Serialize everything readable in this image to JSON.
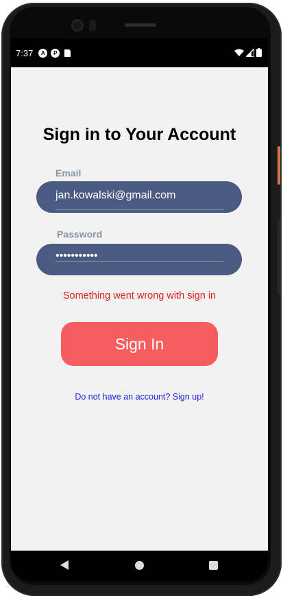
{
  "status_bar": {
    "time": "7:37",
    "left_icons": [
      "app-a-icon",
      "app-p-icon",
      "sd-card-icon"
    ],
    "right_icons": [
      "wifi-icon",
      "signal-icon",
      "battery-icon"
    ]
  },
  "screen": {
    "title": "Sign in to Your Account",
    "email": {
      "label": "Email",
      "value": "jan.kowalski@gmail.com"
    },
    "password": {
      "label": "Password",
      "value": "•••••••••••"
    },
    "error_message": "Something went wrong with sign in",
    "sign_in_button": "Sign In",
    "sign_up_link": "Do not have an account? Sign up!"
  },
  "colors": {
    "input_background": "#4b5a80",
    "button": "#f75c5f",
    "error": "#e0201c",
    "link": "#1e1ee6",
    "screen_background": "#f2f2f2"
  },
  "nav_bar": {
    "buttons": [
      "back-icon",
      "home-icon",
      "recents-icon"
    ]
  }
}
